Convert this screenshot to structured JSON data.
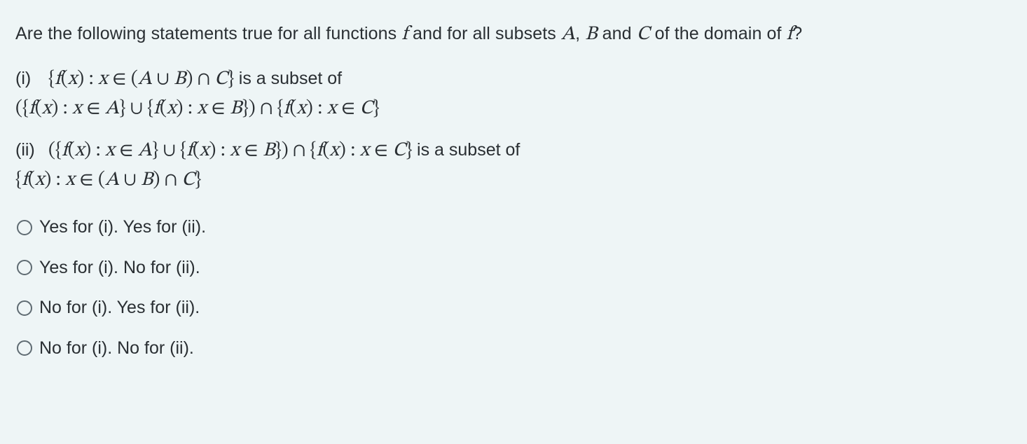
{
  "question": {
    "intro_pre": "Are the following statements true for all functions ",
    "intro_mid1": " and for all subsets ",
    "intro_mid2": ", ",
    "intro_mid3": " and ",
    "intro_mid4": " of the domain of ",
    "intro_end": "?",
    "f": "f",
    "A": "A",
    "B": "B",
    "C": "C"
  },
  "parts": {
    "i": {
      "label": "(i)",
      "expr1": "{f(x) : x ∈ (A ∪ B) ∩ C}",
      "middle": " is a subset of",
      "expr2": "({f(x) : x ∈ A} ∪ {f(x) : x ∈ B}) ∩ {f(x) : x ∈ C}"
    },
    "ii": {
      "label": "(ii)",
      "expr1": "({f(x) : x ∈ A} ∪ {f(x) : x ∈ B}) ∩ {f(x) : x ∈ C}",
      "middle": " is a subset of",
      "expr2": "{f(x) : x ∈ (A ∪ B) ∩ C}"
    }
  },
  "options": {
    "a": "Yes for (i). Yes for (ii).",
    "b": "Yes for (i). No for (ii).",
    "c": "No for (i). Yes for (ii).",
    "d": "No for (i). No for (ii)."
  }
}
